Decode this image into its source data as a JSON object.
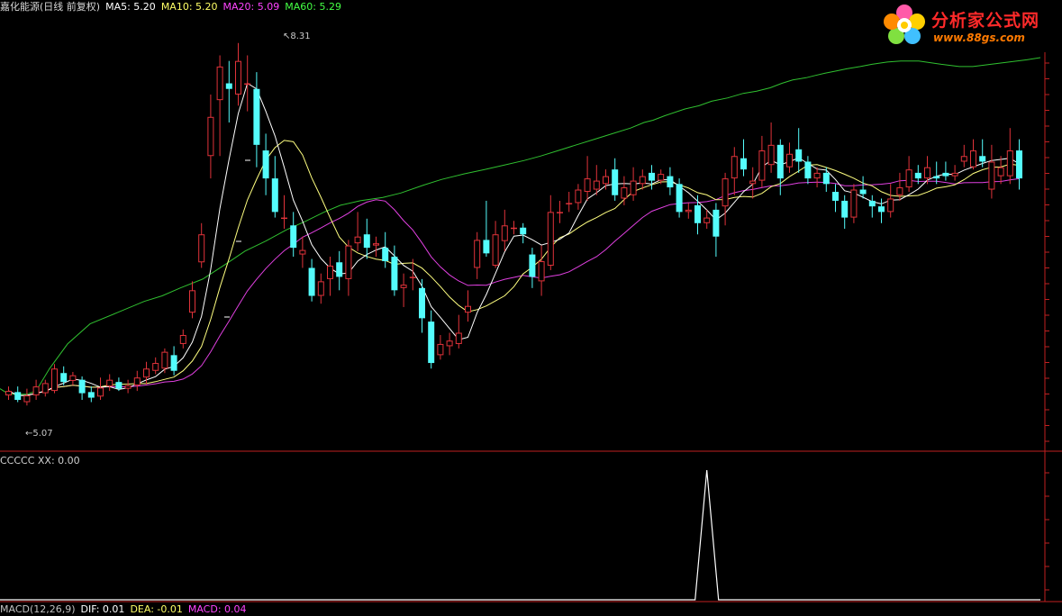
{
  "header": {
    "stock": "嘉化能源(日线 前复权)",
    "ma5": "MA5: 5.20",
    "ma10": "MA10: 5.20",
    "ma20": "MA20: 5.09",
    "ma60": "MA60: 5.29"
  },
  "indicator_header": "CCCCC  XX: 0.00",
  "macd_header": {
    "name": "MACD(12,26,9)",
    "dif": "DIF: 0.01",
    "dea": "DEA: -0.01",
    "macd": "MACD: 0.04"
  },
  "logo": {
    "title": "分析家公式网",
    "url": "www.88gs.com"
  },
  "annotations": {
    "high_label": "8.31",
    "low_label": "5.07"
  },
  "colors": {
    "up": "#e0333a",
    "down": "#54fcfc",
    "ma5": "#ffffff",
    "ma10": "#ffff80",
    "ma20": "#e040e0",
    "ma60": "#30c030",
    "divider": "#c02020",
    "indicator": "#ffffff"
  },
  "chart_data": {
    "type": "candlestick",
    "y_range": [
      4.75,
      8.55
    ],
    "days": [
      [
        5.16,
        5.2,
        5.24,
        5.12
      ],
      [
        5.19,
        5.12,
        5.24,
        5.1
      ],
      [
        5.1,
        5.16,
        5.22,
        5.07
      ],
      [
        5.16,
        5.24,
        5.3,
        5.12
      ],
      [
        5.18,
        5.27,
        5.3,
        5.15
      ],
      [
        5.2,
        5.4,
        5.44,
        5.18
      ],
      [
        5.36,
        5.28,
        5.42,
        5.25
      ],
      [
        5.29,
        5.34,
        5.37,
        5.25
      ],
      [
        5.3,
        5.18,
        5.33,
        5.12
      ],
      [
        5.19,
        5.14,
        5.24,
        5.1
      ],
      [
        5.15,
        5.23,
        5.32,
        5.12
      ],
      [
        5.24,
        5.3,
        5.35,
        5.2
      ],
      [
        5.28,
        5.22,
        5.32,
        5.2
      ],
      [
        5.22,
        5.25,
        5.3,
        5.18
      ],
      [
        5.25,
        5.32,
        5.38,
        5.2
      ],
      [
        5.32,
        5.4,
        5.46,
        5.26
      ],
      [
        5.38,
        5.45,
        5.5,
        5.35
      ],
      [
        5.4,
        5.55,
        5.58,
        5.36
      ],
      [
        5.52,
        5.38,
        5.6,
        5.34
      ],
      [
        5.62,
        5.7,
        5.75,
        5.58
      ],
      [
        5.9,
        6.1,
        6.18,
        5.85
      ],
      [
        6.35,
        6.6,
        6.7,
        6.3
      ],
      [
        7.3,
        7.65,
        7.85,
        7.1
      ],
      [
        7.8,
        8.1,
        8.2,
        7.3
      ],
      [
        7.95,
        7.9,
        8.15,
        7.6
      ],
      [
        7.85,
        8.15,
        8.31,
        7.75
      ],
      [
        7.95,
        7.95,
        8.2,
        7.7
      ],
      [
        7.9,
        7.4,
        8.05,
        7.2
      ],
      [
        7.35,
        7.1,
        7.5,
        6.95
      ],
      [
        7.1,
        6.8,
        7.3,
        6.75
      ],
      [
        6.75,
        6.75,
        6.95,
        6.65
      ],
      [
        6.68,
        6.48,
        6.8,
        6.4
      ],
      [
        6.42,
        6.46,
        6.58,
        6.3
      ],
      [
        6.3,
        6.05,
        6.38,
        6.0
      ],
      [
        6.05,
        6.18,
        6.25,
        5.98
      ],
      [
        6.2,
        6.32,
        6.4,
        6.05
      ],
      [
        6.35,
        6.22,
        6.45,
        6.1
      ],
      [
        6.2,
        6.5,
        6.55,
        6.05
      ],
      [
        6.52,
        6.58,
        6.8,
        6.45
      ],
      [
        6.6,
        6.48,
        6.74,
        6.38
      ],
      [
        6.5,
        6.52,
        6.58,
        6.4
      ],
      [
        6.48,
        6.36,
        6.62,
        6.3
      ],
      [
        6.4,
        6.1,
        6.5,
        6.05
      ],
      [
        6.12,
        6.15,
        6.25,
        5.95
      ],
      [
        6.22,
        6.22,
        6.38,
        6.1
      ],
      [
        6.12,
        5.85,
        6.2,
        5.72
      ],
      [
        5.82,
        5.45,
        5.92,
        5.4
      ],
      [
        5.52,
        5.62,
        5.7,
        5.48
      ],
      [
        5.6,
        5.65,
        5.72,
        5.52
      ],
      [
        5.62,
        5.72,
        5.88,
        5.58
      ],
      [
        5.9,
        5.96,
        6.1,
        5.82
      ],
      [
        6.3,
        6.55,
        6.62,
        6.2
      ],
      [
        6.55,
        6.43,
        6.9,
        6.4
      ],
      [
        6.32,
        6.6,
        6.72,
        6.3
      ],
      [
        6.54,
        6.68,
        6.82,
        6.45
      ],
      [
        6.65,
        6.66,
        6.72,
        6.6
      ],
      [
        6.66,
        6.6,
        6.7,
        6.52
      ],
      [
        6.42,
        6.22,
        6.48,
        6.12
      ],
      [
        6.18,
        6.36,
        6.5,
        6.05
      ],
      [
        6.32,
        6.8,
        6.95,
        6.28
      ],
      [
        6.8,
        6.8,
        6.9,
        6.7
      ],
      [
        6.88,
        6.88,
        6.98,
        6.8
      ],
      [
        6.88,
        7.0,
        7.05,
        6.82
      ],
      [
        6.98,
        7.1,
        7.3,
        6.9
      ],
      [
        7.0,
        7.08,
        7.22,
        6.95
      ],
      [
        7.05,
        7.12,
        7.18,
        7.0
      ],
      [
        7.18,
        6.95,
        7.28,
        6.9
      ],
      [
        6.92,
        7.02,
        7.12,
        6.86
      ],
      [
        6.95,
        7.08,
        7.2,
        6.9
      ],
      [
        7.05,
        7.12,
        7.18,
        7.0
      ],
      [
        7.15,
        7.08,
        7.22,
        7.0
      ],
      [
        7.08,
        7.14,
        7.18,
        7.05
      ],
      [
        7.12,
        7.02,
        7.2,
        6.95
      ],
      [
        7.05,
        6.8,
        7.1,
        6.75
      ],
      [
        6.8,
        6.82,
        6.88,
        6.74
      ],
      [
        6.86,
        6.7,
        6.95,
        6.6
      ],
      [
        6.7,
        6.75,
        6.82,
        6.65
      ],
      [
        6.82,
        6.58,
        6.88,
        6.4
      ],
      [
        6.85,
        7.1,
        7.15,
        6.68
      ],
      [
        7.1,
        7.3,
        7.38,
        6.95
      ],
      [
        7.28,
        7.18,
        7.45,
        7.12
      ],
      [
        7.05,
        7.08,
        7.2,
        6.92
      ],
      [
        7.08,
        7.35,
        7.48,
        7.02
      ],
      [
        7.22,
        7.4,
        7.6,
        7.15
      ],
      [
        7.4,
        7.1,
        7.45,
        6.95
      ],
      [
        7.2,
        7.32,
        7.42,
        7.15
      ],
      [
        7.36,
        7.25,
        7.55,
        7.15
      ],
      [
        7.25,
        7.1,
        7.3,
        7.05
      ],
      [
        7.1,
        7.15,
        7.2,
        7.02
      ],
      [
        7.15,
        7.05,
        7.2,
        6.98
      ],
      [
        6.98,
        6.9,
        7.05,
        6.8
      ],
      [
        6.9,
        6.75,
        6.95,
        6.65
      ],
      [
        6.75,
        7.0,
        7.05,
        6.7
      ],
      [
        7.0,
        6.96,
        7.12,
        6.92
      ],
      [
        6.9,
        6.85,
        6.95,
        6.75
      ],
      [
        6.85,
        6.8,
        6.92,
        6.7
      ],
      [
        6.8,
        6.92,
        7.05,
        6.75
      ],
      [
        6.95,
        7.02,
        7.15,
        6.9
      ],
      [
        7.02,
        7.18,
        7.3,
        6.98
      ],
      [
        7.15,
        7.1,
        7.22,
        7.05
      ],
      [
        7.1,
        7.2,
        7.3,
        7.05
      ],
      [
        7.12,
        7.1,
        7.25,
        7.05
      ],
      [
        7.15,
        7.12,
        7.25,
        7.08
      ],
      [
        7.12,
        7.15,
        7.22,
        7.08
      ],
      [
        7.25,
        7.3,
        7.4,
        7.2
      ],
      [
        7.2,
        7.35,
        7.45,
        7.18
      ],
      [
        7.3,
        7.25,
        7.45,
        7.2
      ],
      [
        7.0,
        7.25,
        7.4,
        6.92
      ],
      [
        7.12,
        7.2,
        7.3,
        7.05
      ],
      [
        7.12,
        7.35,
        7.55,
        7.05
      ],
      [
        7.35,
        7.1,
        7.45,
        7.0
      ]
    ],
    "ma60": [
      [
        0,
        5.22
      ],
      [
        10,
        5.17
      ],
      [
        30,
        5.17
      ],
      [
        40,
        5.2
      ],
      [
        55,
        5.4
      ],
      [
        75,
        5.62
      ],
      [
        100,
        5.8
      ],
      [
        130,
        5.9
      ],
      [
        160,
        6.0
      ],
      [
        180,
        6.05
      ],
      [
        200,
        6.12
      ],
      [
        225,
        6.2
      ],
      [
        250,
        6.33
      ],
      [
        272,
        6.45
      ],
      [
        295,
        6.54
      ],
      [
        318,
        6.64
      ],
      [
        340,
        6.72
      ],
      [
        360,
        6.8
      ],
      [
        378,
        6.86
      ],
      [
        400,
        6.9
      ],
      [
        425,
        6.93
      ],
      [
        445,
        6.97
      ],
      [
        470,
        7.04
      ],
      [
        490,
        7.09
      ],
      [
        515,
        7.14
      ],
      [
        538,
        7.18
      ],
      [
        560,
        7.22
      ],
      [
        582,
        7.26
      ],
      [
        600,
        7.3
      ],
      [
        620,
        7.35
      ],
      [
        640,
        7.4
      ],
      [
        660,
        7.45
      ],
      [
        680,
        7.5
      ],
      [
        700,
        7.55
      ],
      [
        715,
        7.6
      ],
      [
        725,
        7.62
      ],
      [
        738,
        7.66
      ],
      [
        760,
        7.72
      ],
      [
        776,
        7.75
      ],
      [
        790,
        7.79
      ],
      [
        808,
        7.82
      ],
      [
        825,
        7.86
      ],
      [
        840,
        7.88
      ],
      [
        855,
        7.91
      ],
      [
        868,
        7.95
      ],
      [
        880,
        7.98
      ],
      [
        895,
        8.0
      ],
      [
        905,
        8.02
      ],
      [
        916,
        8.04
      ],
      [
        928,
        8.06
      ],
      [
        940,
        8.08
      ],
      [
        955,
        8.1
      ],
      [
        968,
        8.12
      ],
      [
        985,
        8.14
      ],
      [
        1000,
        8.15
      ],
      [
        1020,
        8.15
      ],
      [
        1045,
        8.12
      ],
      [
        1065,
        8.1
      ],
      [
        1080,
        8.1
      ],
      [
        1100,
        8.12
      ],
      [
        1120,
        8.14
      ],
      [
        1140,
        8.16
      ],
      [
        1155,
        8.18
      ]
    ],
    "indicator": {
      "label": "XX",
      "value": "0.00",
      "spike_at_day": 76,
      "baseline": 0,
      "spike_value": 1
    }
  }
}
